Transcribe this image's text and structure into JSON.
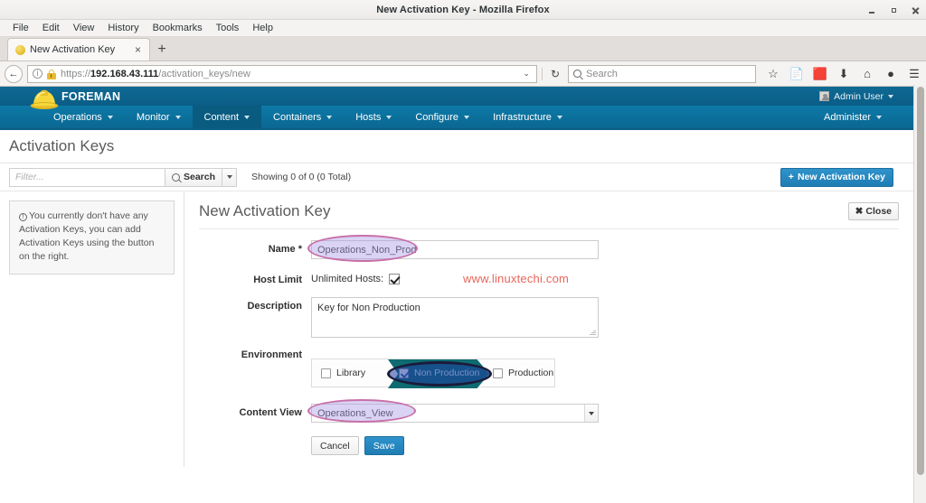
{
  "window": {
    "title": "New Activation Key - Mozilla Firefox",
    "minimize_label": "Minimize",
    "maximize_label": "Maximize",
    "close_label": "Close"
  },
  "menubar": {
    "items": [
      "File",
      "Edit",
      "View",
      "History",
      "Bookmarks",
      "Tools",
      "Help"
    ]
  },
  "tab": {
    "title": "New Activation Key",
    "close_label": "×",
    "newtab_label": "+"
  },
  "addressbar": {
    "back_label": "←",
    "identity_icon": "info-icon",
    "security_icon": "lock-warning-icon",
    "url_scheme": "https://",
    "url_host": "192.168.43.111",
    "url_path": "/activation_keys/new",
    "dropdown_label": "⌄",
    "reload_label": "↻",
    "search_placeholder": "Search",
    "icons": [
      "bookmark-star-icon",
      "reader-icon",
      "pocket-icon",
      "download-icon",
      "home-icon",
      "sync-icon",
      "menu-icon"
    ]
  },
  "foreman": {
    "brand": "FOREMAN",
    "logo_icon": "hard-hat-icon",
    "user": "Admin User",
    "user_caret": "⌄",
    "nav_items": [
      {
        "label": "Operations",
        "active": false
      },
      {
        "label": "Monitor",
        "active": false
      },
      {
        "label": "Content",
        "active": true
      },
      {
        "label": "Containers",
        "active": false
      },
      {
        "label": "Hosts",
        "active": false
      },
      {
        "label": "Configure",
        "active": false
      },
      {
        "label": "Infrastructure",
        "active": false
      }
    ],
    "nav_right": [
      {
        "label": "Administer"
      }
    ]
  },
  "page": {
    "title": "Activation Keys"
  },
  "toolbar": {
    "filter_placeholder": "Filter...",
    "filter_value": "",
    "search_label": "Search",
    "search_icon": "magnifier-icon",
    "search_caret": "▾",
    "showing": "Showing 0 of 0 (0 Total)",
    "new_button": "New Activation Key",
    "new_button_icon": "+"
  },
  "sidebar": {
    "info_icon": "info-circle-icon",
    "info_text": "You currently don't have any Activation Keys, you can add Activation Keys using the button on the right."
  },
  "form": {
    "title": "New Activation Key",
    "close_button": "Close",
    "close_icon": "✖",
    "fields": {
      "name": {
        "label": "Name",
        "required_mark": "*",
        "value": "Operations_Non_Prod"
      },
      "host_limit": {
        "label": "Host Limit",
        "checkbox_label": "Unlimited Hosts:",
        "checked": true
      },
      "description": {
        "label": "Description",
        "value": "Key for Non Production"
      },
      "environment": {
        "label": "Environment",
        "options": [
          {
            "label": "Library",
            "checked": false,
            "selected": false
          },
          {
            "label": "Non Production",
            "checked": true,
            "selected": true
          },
          {
            "label": "Production",
            "checked": false,
            "selected": false
          }
        ]
      },
      "content_view": {
        "label": "Content View",
        "value": "Operations_View",
        "dropdown_icon": "chevron-down-icon"
      }
    },
    "cancel_button": "Cancel",
    "save_button": "Save"
  },
  "watermark": {
    "text": "www.linuxtechi.com",
    "color": "#e8665c"
  },
  "annotations": {
    "name_highlight": "ellipse-pink",
    "environment_highlight": "ellipse-navy",
    "content_view_highlight": "ellipse-pink"
  },
  "theme": {
    "foreman_top": "#0a5d86",
    "foreman_nav": "#0b6e9c",
    "foreman_nav_active": "#0a5b80",
    "accent_blue": "#2a8bc4",
    "env_chevron_teal": "#0e6b71",
    "env_selected_blue": "#2a46a8"
  }
}
